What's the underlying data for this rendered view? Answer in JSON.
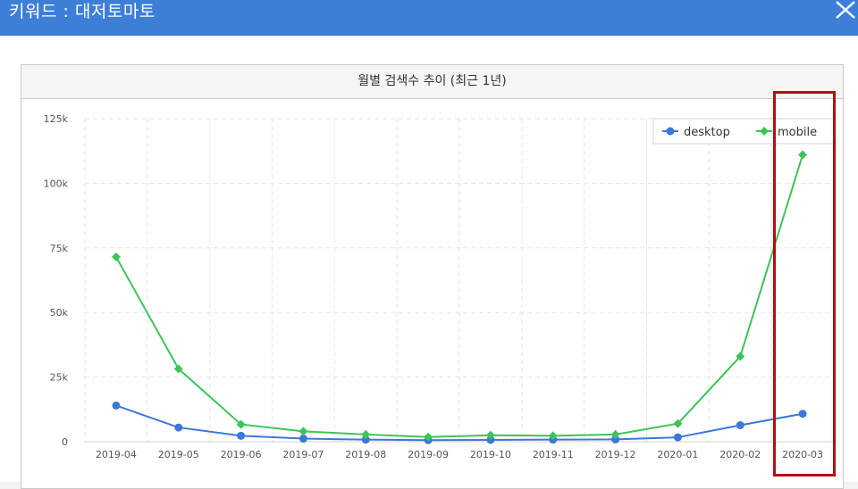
{
  "header": {
    "title": "키워드 : 대저토마토",
    "close_icon": "close-icon"
  },
  "panel": {
    "title": "월별 검색수 추이 (최근 1년)"
  },
  "chart_data": {
    "type": "line",
    "title": "월별 검색수 추이 (최근 1년)",
    "x": [
      "2019-04",
      "2019-05",
      "2019-06",
      "2019-07",
      "2019-08",
      "2019-09",
      "2019-10",
      "2019-11",
      "2019-12",
      "2020-01",
      "2020-02",
      "2020-03"
    ],
    "series": [
      {
        "name": "desktop",
        "color": "#3b78d8",
        "marker": "circle",
        "values": [
          14000,
          5500,
          2300,
          1200,
          800,
          600,
          700,
          800,
          900,
          1700,
          6400,
          10800
        ]
      },
      {
        "name": "mobile",
        "color": "#3cc45a",
        "marker": "diamond",
        "values": [
          71500,
          28200,
          6700,
          4000,
          2800,
          1800,
          2500,
          2300,
          2800,
          7000,
          33000,
          111000
        ]
      }
    ],
    "yticks": [
      "0",
      "25k",
      "50k",
      "75k",
      "100k",
      "125k"
    ],
    "ylim": [
      0,
      125000
    ],
    "grid": true,
    "legend_position": "top-right",
    "xlabel": "",
    "ylabel": ""
  },
  "annotation": {
    "highlight_color": "#b01010",
    "highlight_target": "2020-03"
  }
}
